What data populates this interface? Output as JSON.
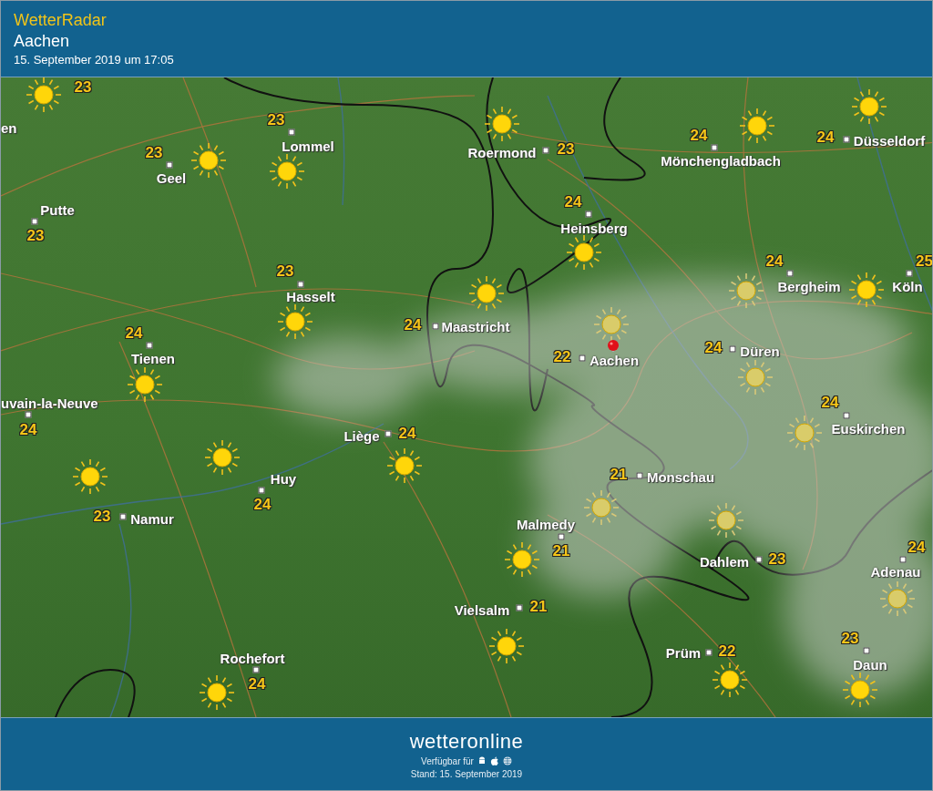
{
  "header": {
    "app_name": "WetterRadar",
    "location": "Aachen",
    "timestamp": "15. September 2019 um 17:05"
  },
  "map": {
    "places": [
      {
        "name": "en",
        "temp": "23"
      },
      {
        "name": "Geel",
        "temp": "23"
      },
      {
        "name": "Lommel",
        "temp": "23"
      },
      {
        "name": "Putte",
        "temp": "23"
      },
      {
        "name": "Hasselt",
        "temp": "23"
      },
      {
        "name": "Tienen",
        "temp": "24"
      },
      {
        "name": "Maastricht",
        "temp": "24"
      },
      {
        "name": "uvain-la-Neuve",
        "temp": "24"
      },
      {
        "name": "Liège",
        "temp": "24"
      },
      {
        "name": "Huy",
        "temp": "24"
      },
      {
        "name": "Namur",
        "temp": "23"
      },
      {
        "name": "Rochefort",
        "temp": "24"
      },
      {
        "name": "Roermond",
        "temp": "23"
      },
      {
        "name": "Mönchengladbach",
        "temp": "24"
      },
      {
        "name": "Düsseldorf",
        "temp": "24"
      },
      {
        "name": "Heinsberg",
        "temp": "24"
      },
      {
        "name": "Bergheim",
        "temp": "24"
      },
      {
        "name": "Köln",
        "temp": "25"
      },
      {
        "name": "Aachen",
        "temp": "22"
      },
      {
        "name": "Düren",
        "temp": "24"
      },
      {
        "name": "Euskirchen",
        "temp": "24"
      },
      {
        "name": "Monschau",
        "temp": "21"
      },
      {
        "name": "Malmedy",
        "temp": "21"
      },
      {
        "name": "Dahlem",
        "temp": "23"
      },
      {
        "name": "Vielsalm",
        "temp": "21"
      },
      {
        "name": "Adenau",
        "temp": "24"
      },
      {
        "name": "Prüm",
        "temp": "22"
      },
      {
        "name": "Daun",
        "temp": "23"
      }
    ]
  },
  "footer": {
    "logo": "wetteronline",
    "availability": "Verfügbar für",
    "status": "Stand: 15. September 2019"
  }
}
